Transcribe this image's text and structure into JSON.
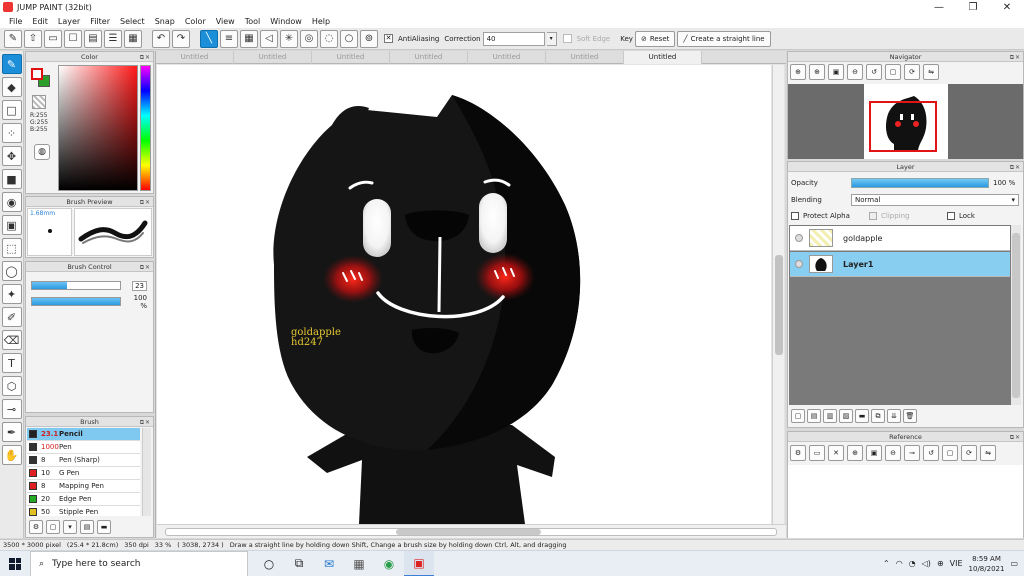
{
  "window": {
    "title": "JUMP PAINT (32bit)",
    "minimize": "—",
    "maximize": "❐",
    "close": "✕"
  },
  "menu": [
    "File",
    "Edit",
    "Layer",
    "Filter",
    "Select",
    "Snap",
    "Color",
    "View",
    "Tool",
    "Window",
    "Help"
  ],
  "toolbar": {
    "antialiasing_label": "AntiAliasing",
    "antialiasing_checked": "✕",
    "correction_label": "Correction",
    "correction_value": "40",
    "soft_edge_label": "Soft Edge",
    "key_label": "Key",
    "reset_label": "Reset",
    "straight_line_label": "Create a straight line"
  },
  "color_panel": {
    "title": "Color",
    "r": "R:255",
    "g": "G:255",
    "b": "B:255"
  },
  "brush_preview": {
    "title": "Brush Preview",
    "size": "1.68mm"
  },
  "brush_control": {
    "title": "Brush Control",
    "size_value": "23",
    "size_fraction": 0.4,
    "opacity_value": "100 %",
    "opacity_fraction": 1.0
  },
  "brush_panel": {
    "title": "Brush",
    "items": [
      {
        "size": "23.1",
        "name": "Pencil",
        "color": "#222222"
      },
      {
        "size": "1000",
        "name": "Pen",
        "color": "#333333"
      },
      {
        "size": "8",
        "name": "Pen (Sharp)",
        "color": "#333333"
      },
      {
        "size": "10",
        "name": "G Pen",
        "color": "#e02020"
      },
      {
        "size": "8",
        "name": "Mapping Pen",
        "color": "#e02020"
      },
      {
        "size": "20",
        "name": "Edge Pen",
        "color": "#22aa22"
      },
      {
        "size": "50",
        "name": "Stipple Pen",
        "color": "#e0c020"
      }
    ]
  },
  "doc_tabs": [
    "Untitled",
    "Untitled",
    "Untitled",
    "Untitled",
    "Untitled",
    "Untitled",
    "Untitled"
  ],
  "canvas": {
    "signature_line1": "goldapple",
    "signature_line2": "hd247"
  },
  "navigator": {
    "title": "Navigator"
  },
  "layer_panel": {
    "title": "Layer",
    "opacity_label": "Opacity",
    "opacity_value": "100 %",
    "blending_label": "Blending",
    "blending_value": "Normal",
    "protect_alpha_label": "Protect Alpha",
    "clipping_label": "Clipping",
    "lock_label": "Lock",
    "layers": [
      {
        "name": "goldapple"
      },
      {
        "name": "Layer1"
      }
    ]
  },
  "reference": {
    "title": "Reference"
  },
  "statusbar": {
    "size": "3500 * 3000 pixel",
    "physical": "(25.4 * 21.8cm)",
    "dpi": "350 dpi",
    "zoom": "33 %",
    "coords": "( 3038, 2734 )",
    "hint": "Draw a straight line by holding down Shift, Change a brush size by holding down Ctrl, Alt, and dragging"
  },
  "taskbar": {
    "search_placeholder": "Type here to search",
    "time": "8:59 AM",
    "date": "10/8/2021",
    "lang": "VIE"
  },
  "colors": {
    "accent": "#1c8fd8",
    "selection": "#87cef0"
  }
}
